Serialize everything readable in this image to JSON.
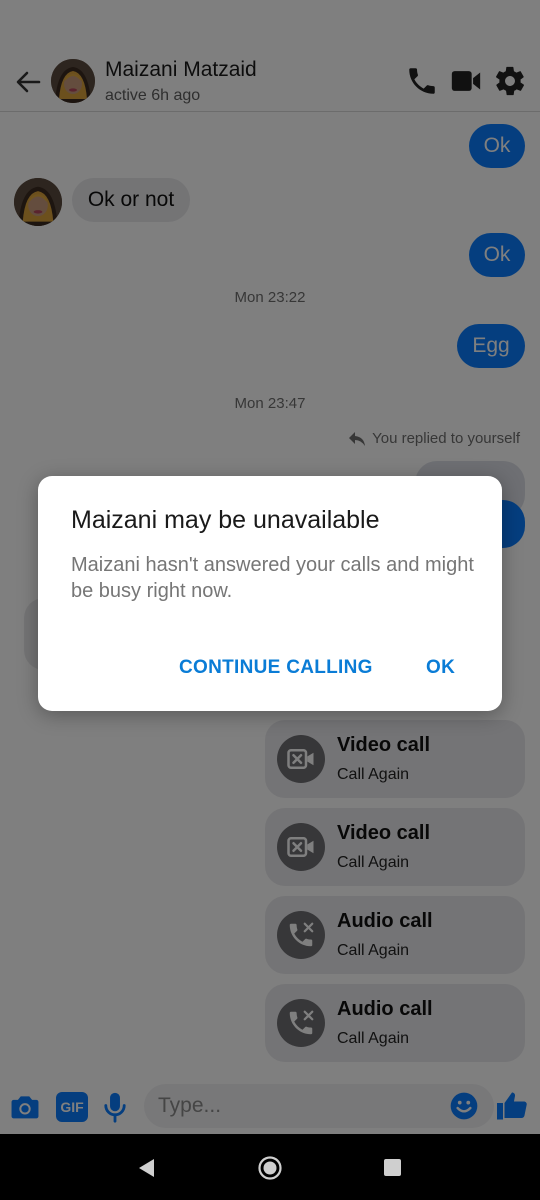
{
  "header": {
    "name": "Maizani Matzaid",
    "status": "active 6h ago",
    "icons": [
      "back-arrow-icon",
      "phone-icon",
      "video-camera-icon",
      "gear-icon"
    ]
  },
  "messages": {
    "out_ok_1": "Ok",
    "in_ok_or_not": "Ok or not",
    "out_ok_2": "Ok",
    "time_1": "Mon 23:22",
    "out_egg": "Egg",
    "time_2": "Mon 23:47",
    "reply_note": "You replied to yourself"
  },
  "call_cards": [
    {
      "title": "Video call",
      "subtitle": "Call Again",
      "icon": "missed-video-call-icon"
    },
    {
      "title": "Video call",
      "subtitle": "Call Again",
      "icon": "missed-video-call-icon"
    },
    {
      "title": "Audio call",
      "subtitle": "Call Again",
      "icon": "missed-audio-call-icon"
    },
    {
      "title": "Audio call",
      "subtitle": "Call Again",
      "icon": "missed-audio-call-icon"
    }
  ],
  "composer": {
    "placeholder": "Type...",
    "gif_label": "GIF",
    "icons": [
      "camera-icon",
      "gif-icon",
      "microphone-icon",
      "emoji-icon",
      "thumbs-up-icon"
    ]
  },
  "dialog": {
    "title": "Maizani may be unavailable",
    "body": "Maizani hasn't answered your calls and might be busy right now.",
    "continue_label": "CONTINUE CALLING",
    "ok_label": "OK"
  },
  "colors": {
    "accent": "#0a7cff",
    "dialog_button": "#0a7cd6",
    "scrim": "rgba(0,0,0,0.5)"
  }
}
